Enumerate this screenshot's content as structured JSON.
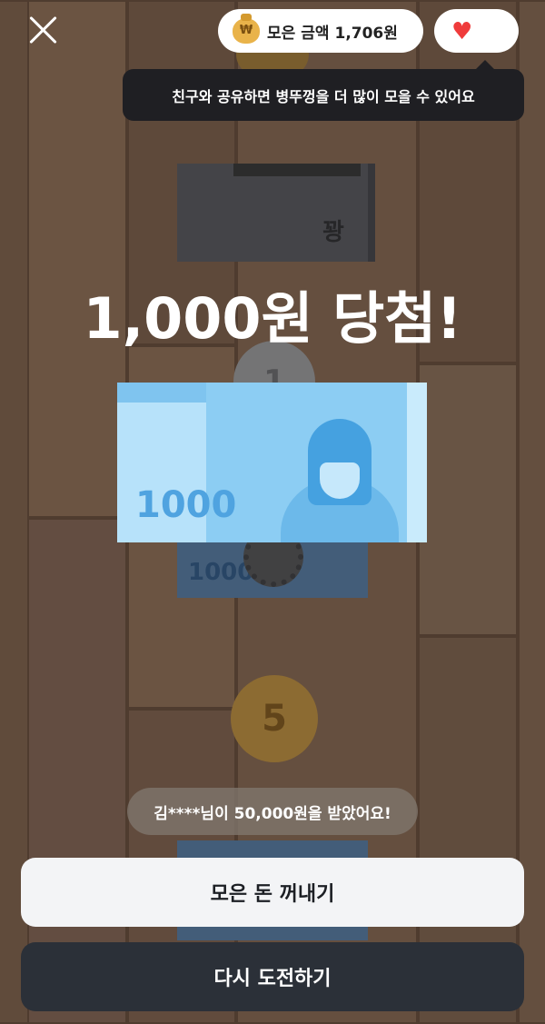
{
  "header": {
    "close_icon": "close-icon",
    "money_label": "모은 금액",
    "money_value": "1,706원",
    "money_icon": "money-bag-icon",
    "bag_symbol": "₩",
    "heart_icon": "heart-icon",
    "heart_glyph": "♥",
    "tooltip": "친구와 공유하면 병뚜껑을 더 많이 모을 수 있어요"
  },
  "background": {
    "note_top_text": "꽝",
    "coin_top_text": "1",
    "note_mid_text": "1000",
    "coin_bottom_text": "5"
  },
  "result": {
    "title": "1,000원 당첨!",
    "bill_amount": "1000"
  },
  "feed": {
    "message": "김****님이 50,000원을 받았어요!"
  },
  "actions": {
    "withdraw_label": "모은 돈 꺼내기",
    "retry_label": "다시 도전하기"
  },
  "colors": {
    "heart": "#ef3b3b",
    "primary_button": "#f3f4f6",
    "secondary_button": "#2b3038",
    "tooltip_bg": "#1f1f23"
  }
}
